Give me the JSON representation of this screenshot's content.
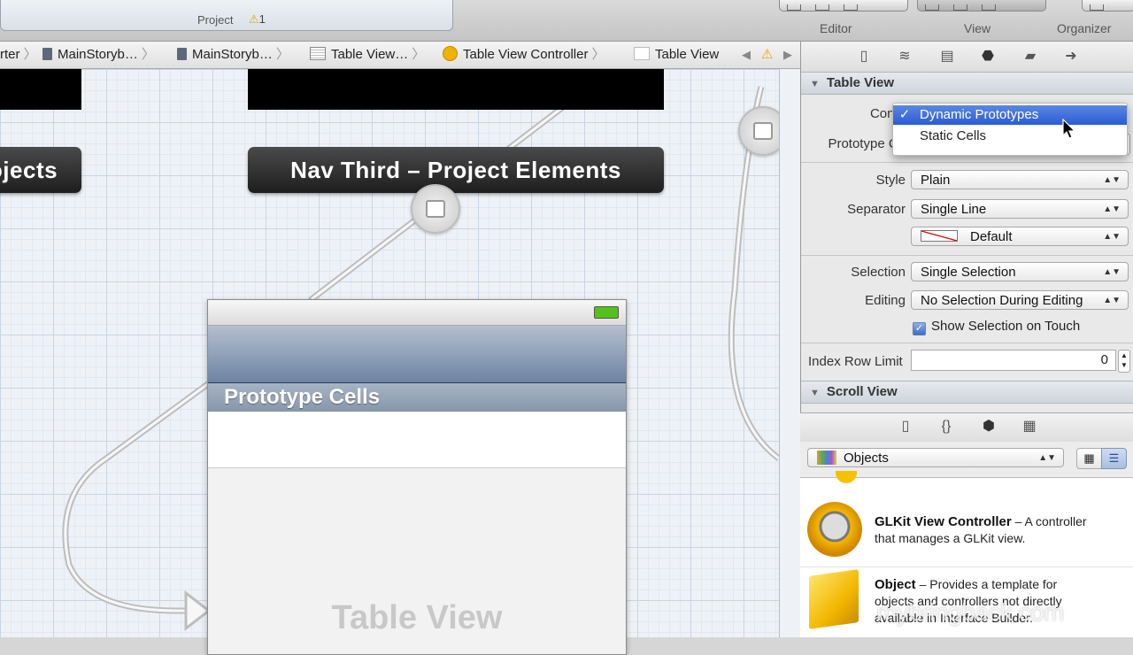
{
  "toolbar": {
    "activity_label": "Project",
    "warning_count": "1",
    "editor_label": "Editor",
    "view_label": "View",
    "organizer_label": "Organizer"
  },
  "jumpbar": {
    "crumbs": [
      "rter",
      "MainStoryb…",
      "MainStoryb…",
      "Table View…",
      "Table View Controller",
      "Table View"
    ]
  },
  "canvas": {
    "scene_left_title": "ojects",
    "scene_mid_title": "Nav Third – Project Elements",
    "section_header": "Prototype Cells",
    "table_view_watermark": "Table View"
  },
  "inspector": {
    "table_view_section": "Table View",
    "content_label": "Conte",
    "prototype_label": "Prototype Ce",
    "style_label": "Style",
    "style_value": "Plain",
    "separator_label": "Separator",
    "separator_value": "Single Line",
    "separator_color": "Default",
    "selection_label": "Selection",
    "selection_value": "Single Selection",
    "editing_label": "Editing",
    "editing_value": "No Selection During Editing",
    "show_selection_label": "Show Selection on Touch",
    "index_row_label": "Index Row Limit",
    "index_row_value": "0",
    "scroll_view_section": "Scroll View"
  },
  "menu": {
    "checkmark": "✓",
    "option_selected": "Dynamic Prototypes",
    "option_other": "Static Cells"
  },
  "library": {
    "filter_value": "Objects",
    "items": [
      {
        "title": "GLKit View Controller",
        "desc1": " – A controller",
        "desc2": "that manages a GLKit view."
      },
      {
        "title": "Object",
        "desc1": " – Provides a template for",
        "desc2": "objects and controllers not directly",
        "desc3": "available in Interface Builder."
      }
    ]
  },
  "watermark": "mybringback.com",
  "colors": {
    "menu_highlight": "#2a5cd5",
    "navbar_blue": "#6d84a2",
    "battery_green": "#55c21b"
  }
}
